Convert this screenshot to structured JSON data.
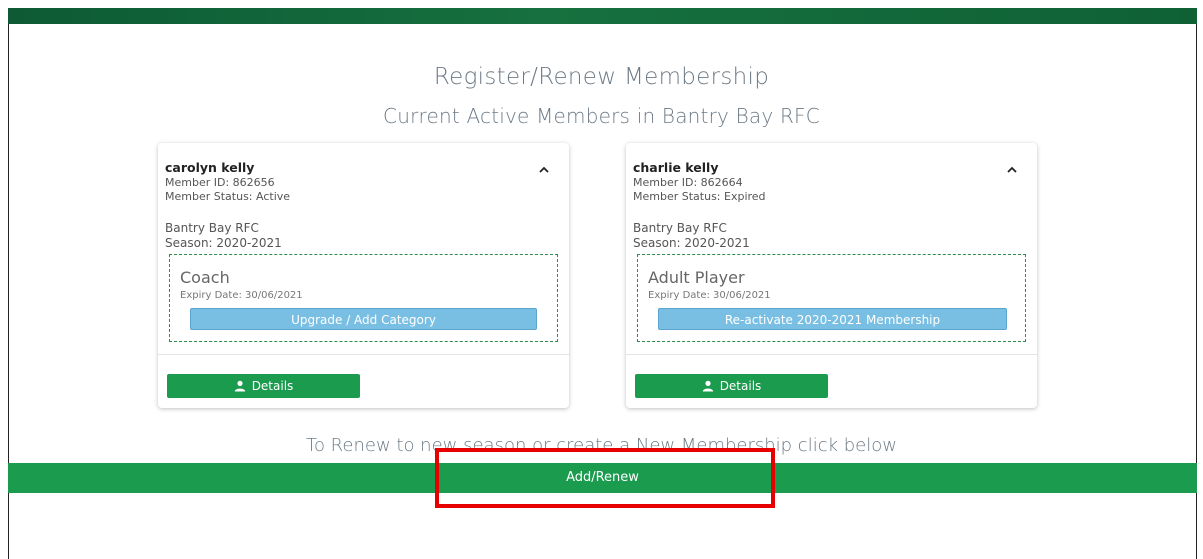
{
  "header": {
    "title": "Register/Renew Membership",
    "subtitle": "Current Active Members in Bantry Bay RFC"
  },
  "members": [
    {
      "name": "carolyn kelly",
      "member_id": "Member ID: 862656",
      "status": "Member Status: Active",
      "club": "Bantry Bay RFC",
      "season": "Season: 2020-2021",
      "category": "Coach",
      "expiry": "Expiry Date: 30/06/2021",
      "action_label": "Upgrade / Add Category",
      "details_label": "Details",
      "collapse_icon": "chevron-up-icon"
    },
    {
      "name": "charlie kelly",
      "member_id": "Member ID: 862664",
      "status": "Member Status: Expired",
      "club": "Bantry Bay RFC",
      "season": "Season: 2020-2021",
      "category": "Adult Player",
      "expiry": "Expiry Date: 30/06/2021",
      "action_label": "Re-activate 2020-2021 Membership",
      "details_label": "Details",
      "collapse_icon": "chevron-up-icon"
    }
  ],
  "footer": {
    "instruction": "To Renew to new season or create a New Membership click below",
    "add_renew_label": "Add/Renew"
  },
  "colors": {
    "brand_green": "#1a9b4e",
    "header_green": "#0f6135",
    "action_blue": "#79bfe3",
    "highlight_red": "#e60000"
  }
}
